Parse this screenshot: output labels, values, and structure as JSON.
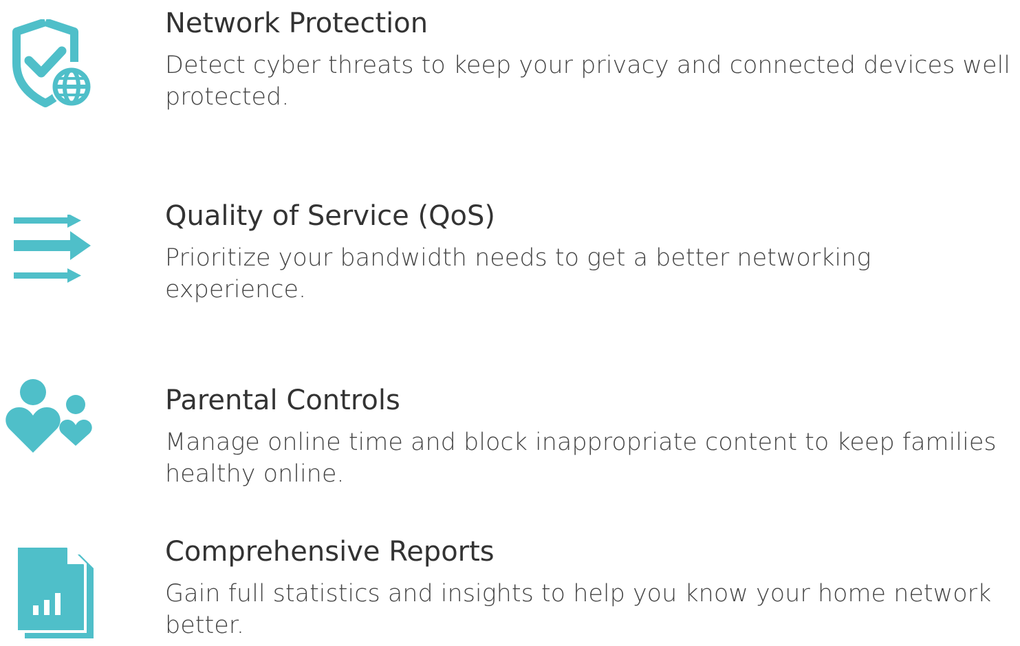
{
  "accent_color": "#4fbfc9",
  "features": [
    {
      "icon": "shield-globe-icon",
      "title": "Network Protection",
      "description": "Detect cyber threats to keep your privacy and connected devices well protected."
    },
    {
      "icon": "arrows-icon",
      "title": "Quality of Service (QoS)",
      "description": "Prioritize your bandwidth needs to get a better networking experience."
    },
    {
      "icon": "family-heart-icon",
      "title": "Parental Controls",
      "description": "Manage online time and block inappropriate content to keep families healthy online."
    },
    {
      "icon": "report-document-icon",
      "title": "Comprehensive Reports",
      "description": "Gain full statistics and insights to help you know your home network better."
    }
  ]
}
